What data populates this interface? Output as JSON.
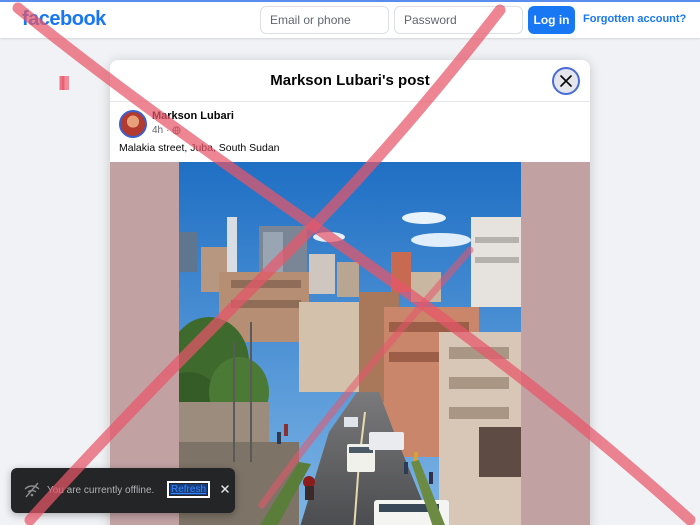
{
  "header": {
    "logo": "facebook",
    "email_placeholder": "Email or phone",
    "password_placeholder": "Password",
    "login_label": "Log in",
    "forgot_label": "Forgotten account?"
  },
  "modal": {
    "title": "Markson Lubari's post",
    "author": "Markson Lubari",
    "time": "4h",
    "caption": "Malakia street, Juba, South Sudan"
  },
  "toast": {
    "message": "You are currently offline.",
    "refresh_label": "Refresh"
  },
  "colors": {
    "brand": "#1877f2",
    "overlay_cross": "#e8566a",
    "media_background": "#c2a1a3"
  },
  "icons": [
    "close-icon",
    "globe-icon",
    "wifi-off-icon",
    "dismiss-icon"
  ]
}
